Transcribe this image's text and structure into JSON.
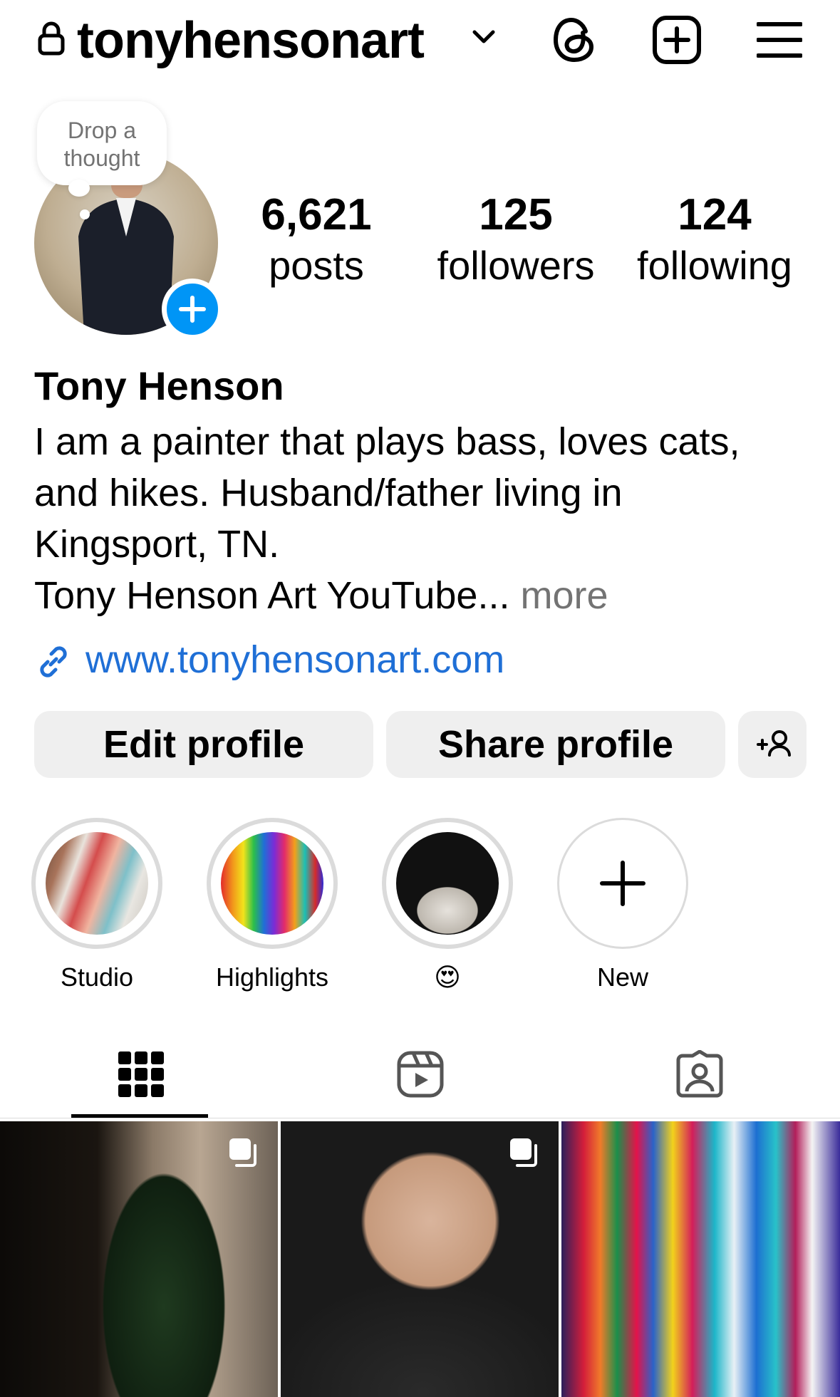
{
  "header": {
    "username": "tonyhensonart",
    "icons": [
      "lock-icon",
      "chevron-down-icon",
      "threads-icon",
      "new-post-icon",
      "menu-icon"
    ]
  },
  "profile": {
    "thought_bubble": [
      "Drop a",
      "thought"
    ],
    "stats": {
      "posts": {
        "value": "6,621",
        "label": "posts"
      },
      "followers": {
        "value": "125",
        "label": "followers"
      },
      "following": {
        "value": "124",
        "label": "following"
      }
    },
    "name": "Tony Henson",
    "bio_lines": [
      "I am a painter that plays bass, loves cats,",
      "and hikes. Husband/father living in",
      "Kingsport, TN.",
      "Tony Henson Art YouTube..."
    ],
    "bio_more": "more",
    "link": "www.tonyhensonart.com"
  },
  "actions": {
    "edit_label": "Edit profile",
    "share_label": "Share profile"
  },
  "highlights": [
    {
      "label": "Studio"
    },
    {
      "label": "Highlights"
    },
    {
      "label": "😍"
    },
    {
      "label": "New"
    }
  ],
  "tabs": [
    "grid-icon",
    "reels-icon",
    "tagged-icon"
  ],
  "colors": {
    "accent": "#0095f6",
    "link": "#1f6fd6",
    "button_bg": "#efefef",
    "muted": "#737373"
  }
}
